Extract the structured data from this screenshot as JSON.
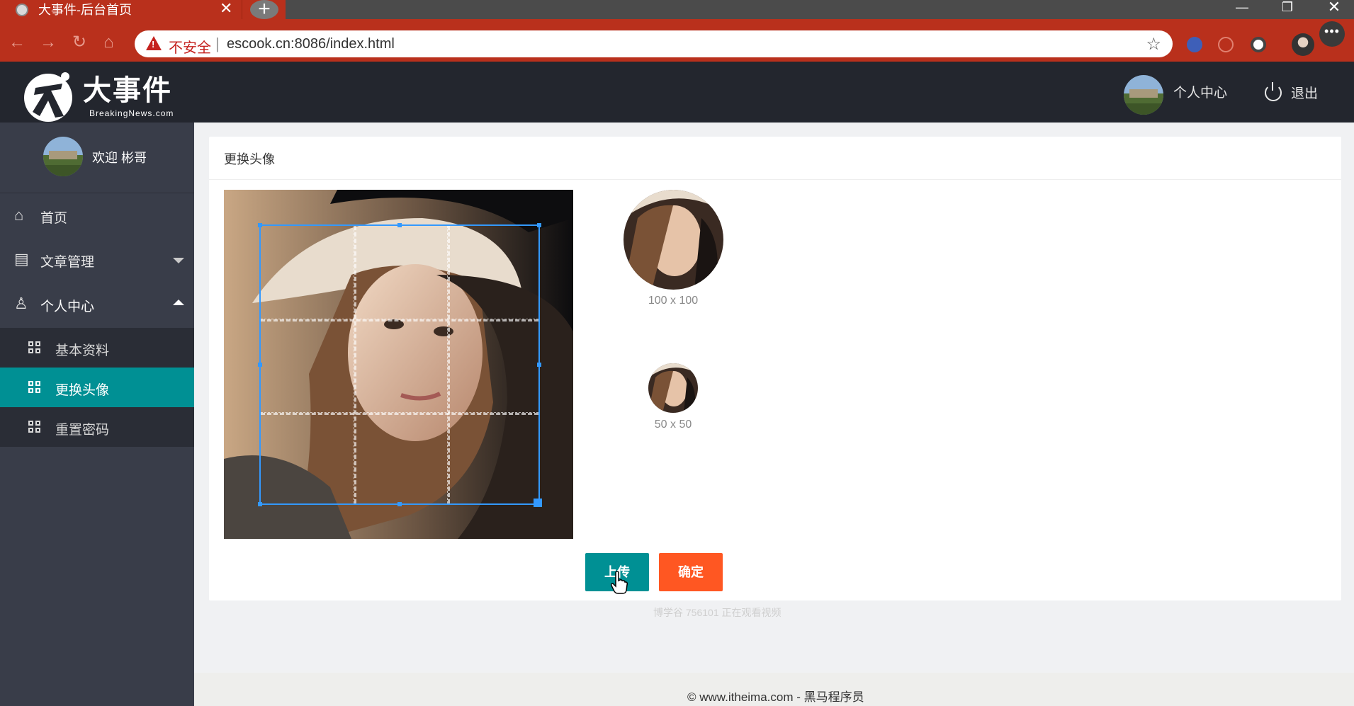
{
  "browser": {
    "tab_title": "大事件-后台首页",
    "tab_close": "✕",
    "new_tab": "+",
    "secure_label": "不安全",
    "url": "escook.cn:8086/index.html",
    "window_controls": {
      "minimize": "—",
      "maximize": "❐",
      "close": "✕"
    },
    "more": "•••"
  },
  "header": {
    "logo_title": "大事件",
    "logo_subtitle": "BreakingNews.com",
    "user_center": "个人中心",
    "logout": "退出"
  },
  "sidebar": {
    "welcome": "欢迎",
    "username": "彬哥",
    "items": [
      {
        "label": "首页",
        "icon": "home-icon"
      },
      {
        "label": "文章管理",
        "icon": "document-icon",
        "expanded": false
      },
      {
        "label": "个人中心",
        "icon": "user-icon",
        "expanded": true
      }
    ],
    "sub_items": [
      {
        "label": "基本资料",
        "icon": "grid-icon",
        "active": false
      },
      {
        "label": "更换头像",
        "icon": "grid-icon",
        "active": true
      },
      {
        "label": "重置密码",
        "icon": "grid-icon",
        "active": false
      }
    ]
  },
  "main": {
    "card_title": "更换头像",
    "preview_large_label": "100 x 100",
    "preview_small_label": "50 x 50",
    "upload_button": "上传",
    "confirm_button": "确定"
  },
  "watermark": "博学谷 756101 正在观看视频",
  "footer": "© www.itheima.com - 黑马程序员",
  "colors": {
    "browser_red": "#b9301c",
    "header_dark": "#23262e",
    "sidebar": "#393d49",
    "active_teal": "#009094",
    "confirm_orange": "#ff5722",
    "crop_blue": "#3399ff"
  }
}
